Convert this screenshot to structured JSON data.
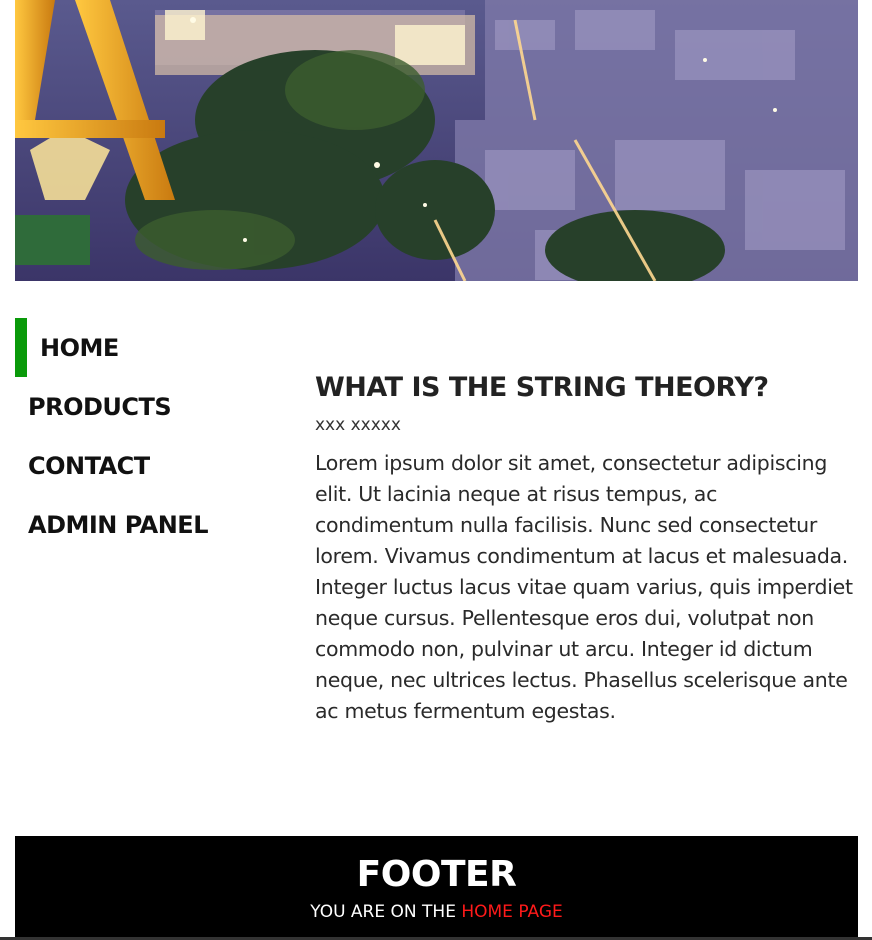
{
  "nav": {
    "items": [
      {
        "label": "HOME",
        "active": true
      },
      {
        "label": "PRODUCTS",
        "active": false
      },
      {
        "label": "CONTACT",
        "active": false
      },
      {
        "label": "ADMIN PANEL",
        "active": false
      }
    ]
  },
  "article": {
    "title": "WHAT IS THE STRING THEORY?",
    "subtitle": "xxx xxxxx",
    "body": "Lorem ipsum dolor sit amet, consectetur adipiscing elit. Ut lacinia neque at risus tempus, ac condimentum nulla facilisis. Nunc sed consectetur lorem. Vivamus condimentum at lacus et malesuada. Integer luctus lacus vitae quam varius, quis imperdiet neque cursus. Pellentesque eros dui, volutpat non commodo non, pulvinar ut arcu. Integer id dictum neque, nec ultrices lectus. Phasellus scelerisque ante ac metus fermentum egestas."
  },
  "footer": {
    "title": "FOOTER",
    "note_prefix": "YOU ARE ON THE ",
    "note_highlight": "HOME PAGE"
  },
  "colors": {
    "active_marker": "#0a9a0a",
    "footer_bg": "#000000",
    "footer_highlight": "#ff1a1a"
  }
}
